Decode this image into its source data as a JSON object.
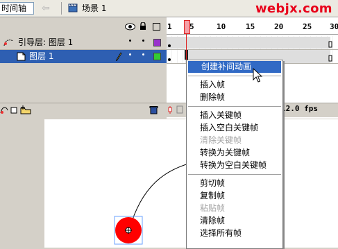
{
  "topbar": {
    "timeline_label": "时间轴",
    "scene_label": "场景 1",
    "watermark": "webjx.com"
  },
  "layers": [
    {
      "name": "引导层: 图层 1",
      "type": "guide",
      "color": "#9933cc"
    },
    {
      "name": "图层 1",
      "type": "normal",
      "color": "#33cc33",
      "selected": true
    }
  ],
  "ruler": {
    "ticks": [
      "1",
      "5",
      "10",
      "15",
      "20",
      "25",
      "30"
    ]
  },
  "status": {
    "fps": "12.0 fps"
  },
  "context_menu": {
    "items": [
      {
        "label": "创建补间动画",
        "state": "highlighted"
      },
      {
        "label": "插入帧",
        "state": "enabled"
      },
      {
        "label": "删除帧",
        "state": "enabled"
      },
      {
        "label": "插入关键帧",
        "state": "enabled"
      },
      {
        "label": "插入空白关键帧",
        "state": "enabled"
      },
      {
        "label": "清除关键帧",
        "state": "disabled"
      },
      {
        "label": "转换为关键帧",
        "state": "enabled"
      },
      {
        "label": "转换为空白关键帧",
        "state": "enabled"
      },
      {
        "label": "剪切帧",
        "state": "enabled"
      },
      {
        "label": "复制帧",
        "state": "enabled"
      },
      {
        "label": "粘贴帧",
        "state": "disabled"
      },
      {
        "label": "清除帧",
        "state": "enabled"
      },
      {
        "label": "选择所有帧",
        "state": "enabled"
      }
    ]
  },
  "colors": {
    "selection_blue": "#2e5fb2",
    "menu_highlight": "#316ac5",
    "playhead_red": "#dd2222",
    "ball_red": "#ff0000",
    "watermark_red": "#e8001a"
  }
}
